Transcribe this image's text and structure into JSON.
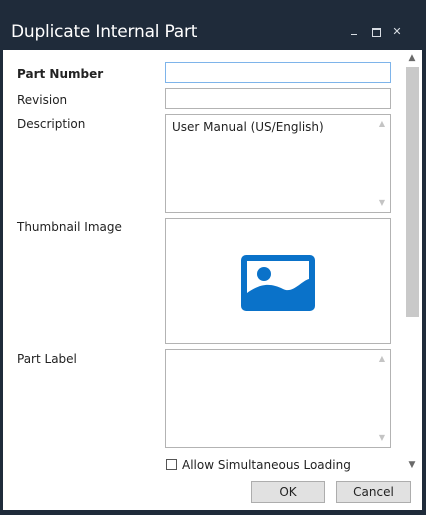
{
  "window": {
    "title": "Duplicate Internal Part",
    "controls": [
      "minimize",
      "maximize",
      "close"
    ]
  },
  "form": {
    "part_number": {
      "label": "Part Number",
      "value": ""
    },
    "revision": {
      "label": "Revision",
      "value": ""
    },
    "description": {
      "label": "Description",
      "value": "User Manual (US/English)"
    },
    "thumbnail": {
      "label": "Thumbnail Image",
      "icon": "image-placeholder-icon"
    },
    "part_label": {
      "label": "Part Label",
      "value": ""
    },
    "allow_simultaneous_loading": {
      "label": "Allow Simultaneous Loading",
      "checked": false
    }
  },
  "buttons": {
    "ok": "OK",
    "cancel": "Cancel"
  },
  "colors": {
    "titlebar": "#1f2b3a",
    "accent": "#0a72c9",
    "focus_border": "#7eb4ea"
  }
}
